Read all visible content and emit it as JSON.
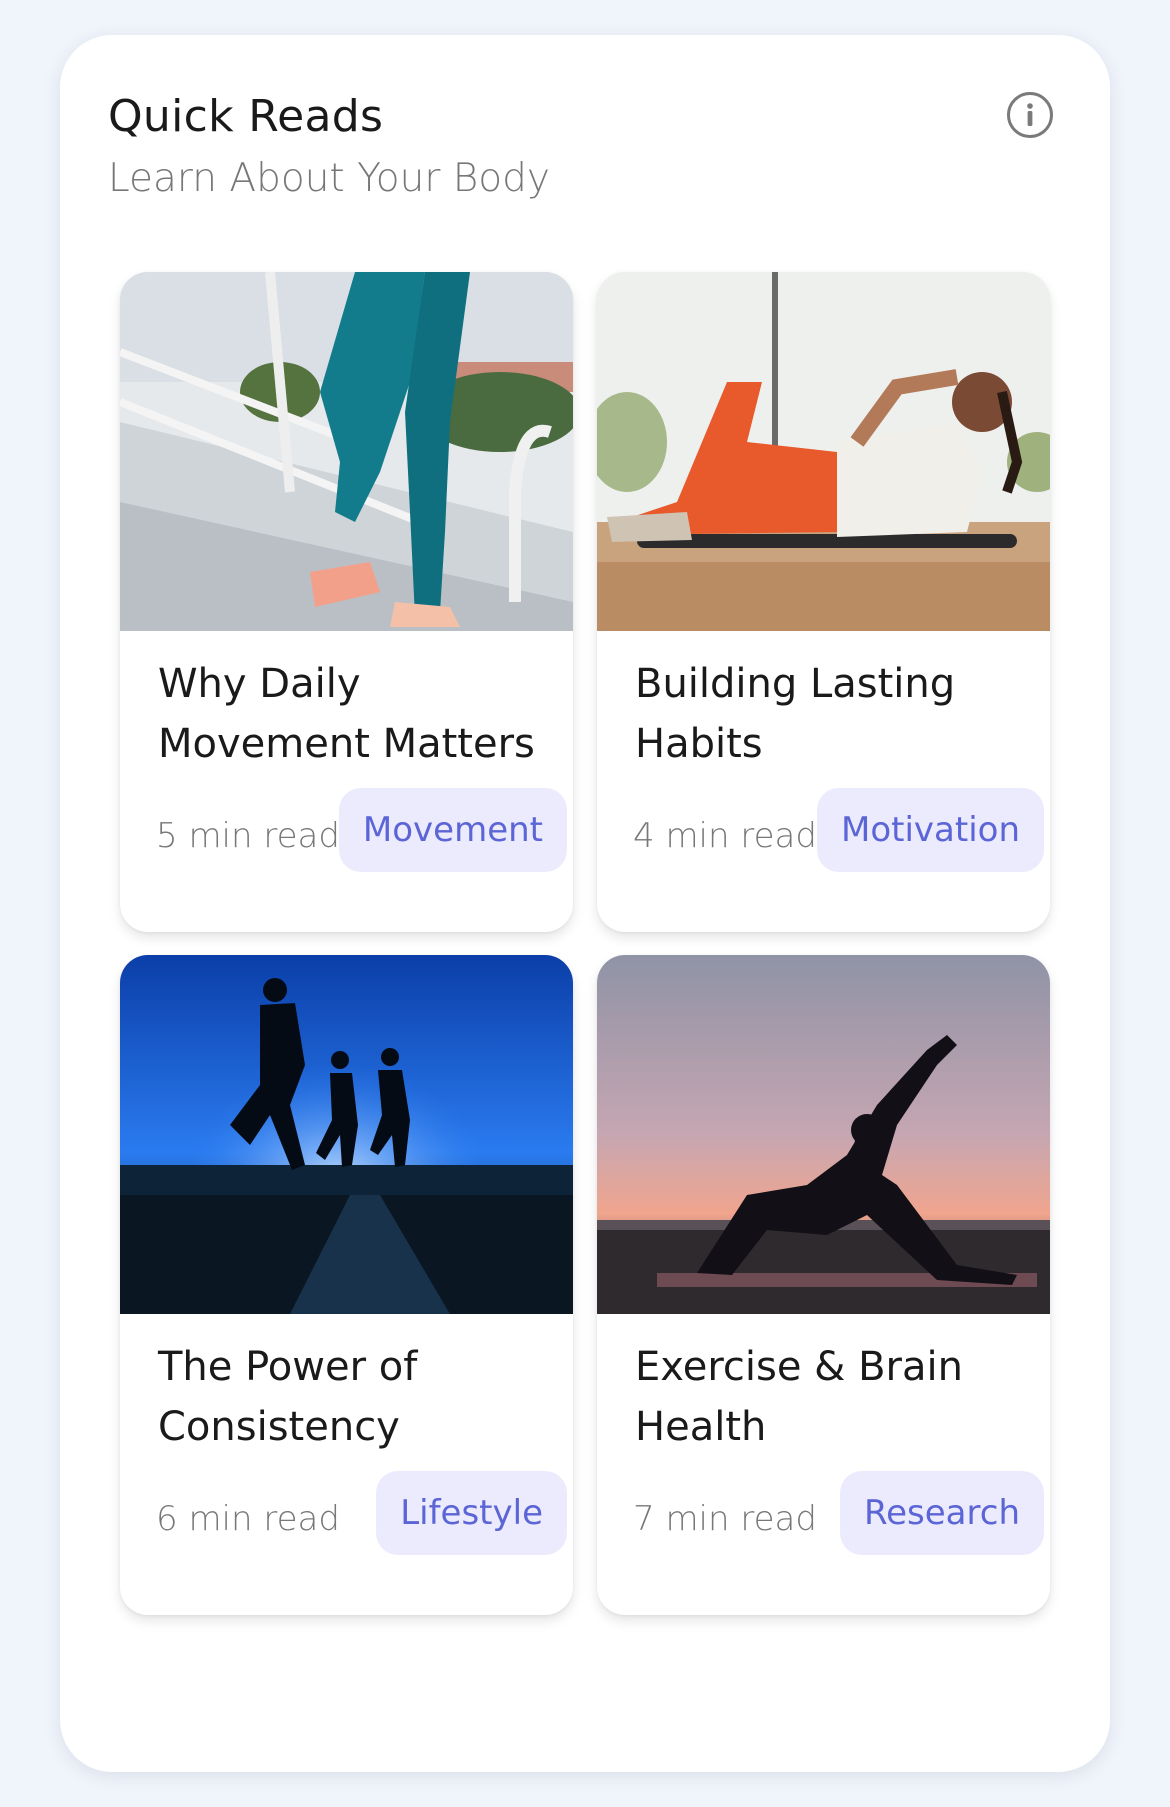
{
  "header": {
    "title": "Quick Reads",
    "subtitle": "Learn About Your Body",
    "info_icon": "info-circle-icon"
  },
  "colors": {
    "page_background": "#f0f4fb",
    "tag_background": "#ebebfd",
    "tag_text": "#5b65d6",
    "title_text": "#1a1a1a",
    "meta_text": "#777777"
  },
  "articles": [
    {
      "title": "Why Daily Movement Matters",
      "read_time": "5 min read",
      "tag": "Movement",
      "image": "woman-climbing-stairs-photo"
    },
    {
      "title": "Building Lasting Habits",
      "read_time": "4 min read",
      "tag": "Motivation",
      "image": "woman-doing-crunches-photo"
    },
    {
      "title": "The Power of Consistency",
      "read_time": "6 min read",
      "tag": "Lifestyle",
      "image": "runners-silhouette-photo"
    },
    {
      "title": "Exercise & Brain Health",
      "read_time": "7 min read",
      "tag": "Research",
      "image": "yoga-sunset-photo"
    }
  ]
}
